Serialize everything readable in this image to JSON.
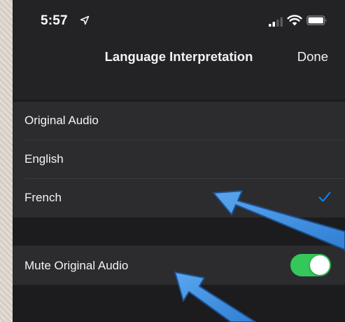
{
  "status_bar": {
    "time": "5:57"
  },
  "nav": {
    "title": "Language Interpretation",
    "done_label": "Done"
  },
  "language_options": [
    {
      "label": "Original Audio",
      "selected": false
    },
    {
      "label": "English",
      "selected": false
    },
    {
      "label": "French",
      "selected": true
    }
  ],
  "mute_row": {
    "label": "Mute Original Audio",
    "toggle_on": true
  },
  "colors": {
    "accent_blue": "#0a84ff",
    "toggle_green": "#34c759",
    "arrow_blue": "#3d8fe0"
  },
  "icons": [
    "location-arrow-icon",
    "signal-icon",
    "wifi-icon",
    "battery-icon",
    "checkmark-icon",
    "arrow-annotation"
  ]
}
